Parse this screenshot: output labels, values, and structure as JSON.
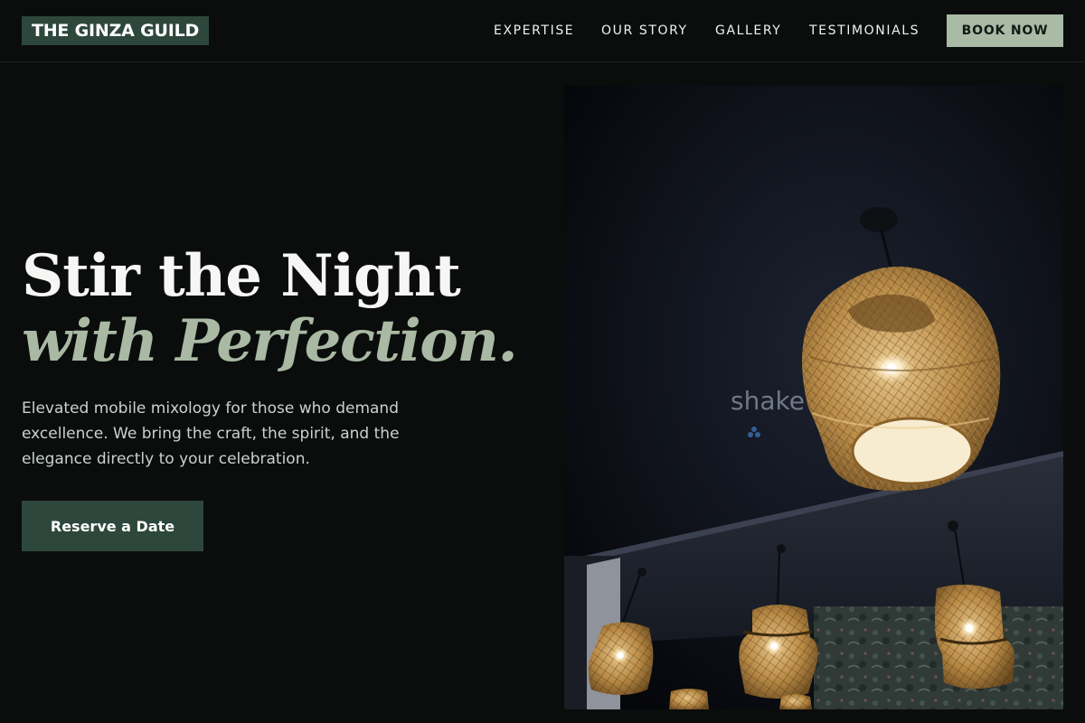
{
  "brand": {
    "logo": "THE GINZA GUILD"
  },
  "nav": {
    "items": [
      {
        "label": "EXPERTISE"
      },
      {
        "label": "OUR STORY"
      },
      {
        "label": "GALLERY"
      },
      {
        "label": "TESTIMONIALS"
      }
    ],
    "cta": "BOOK NOW"
  },
  "hero": {
    "headline_line1": "Stir the Night",
    "headline_line2": "with Perfection.",
    "lead": "Elevated mobile mixology for those who demand excellence. We bring the craft, the spirit, and the elegance directly to your celebration.",
    "cta": "Reserve a Date"
  },
  "photo": {
    "watermark": "shake",
    "subject": "woven rattan pendant lamps"
  },
  "colors": {
    "background": "#0a0d0c",
    "accent_dark": "#2e473c",
    "accent_light": "#a9bba5",
    "headline_italic": "#a9b9a3"
  }
}
